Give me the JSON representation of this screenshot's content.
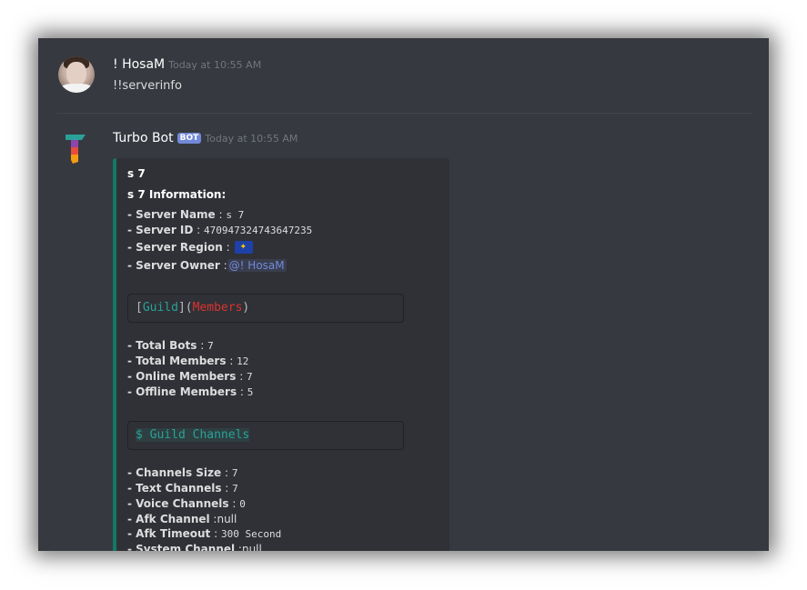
{
  "message1": {
    "author": "! HosaM",
    "timestamp": "Today at 10:55 AM",
    "content": "!!serverinfo"
  },
  "message2": {
    "author": "Turbo Bot",
    "bot_tag": "BOT",
    "timestamp": "Today at 10:55 AM"
  },
  "embed": {
    "title": "s 7",
    "subtitle": "s 7 Information:",
    "accent_color": "#157765",
    "server_name_label": "- Server Name",
    "server_name_value": "s 7",
    "server_id_label": "- Server ID",
    "server_id_value": "470947324743647235",
    "server_region_label": "- Server Region",
    "server_owner_label": "- Server Owner",
    "server_owner_value": "@! HosaM",
    "code1_guild": "Guild",
    "code1_members": "Members",
    "total_bots_label": "- Total Bots",
    "total_bots_value": "7",
    "total_members_label": "- Total Members",
    "total_members_value": "12",
    "online_members_label": "- Online Members",
    "online_members_value": "7",
    "offline_members_label": "- Offline Members",
    "offline_members_value": "5",
    "code2": "$ Guild Channels",
    "channels_size_label": "- Channels Size",
    "channels_size_value": "7",
    "text_channels_label": "- Text Channels",
    "text_channels_value": "7",
    "voice_channels_label": "- Voice Channels",
    "voice_channels_value": "0",
    "afk_channel_label": "- Afk Channel",
    "afk_channel_value": "null",
    "afk_timeout_label": "- Afk Timeout",
    "afk_timeout_value": "300 Second",
    "system_channel_label": "- System Channel",
    "system_channel_value": "null"
  }
}
